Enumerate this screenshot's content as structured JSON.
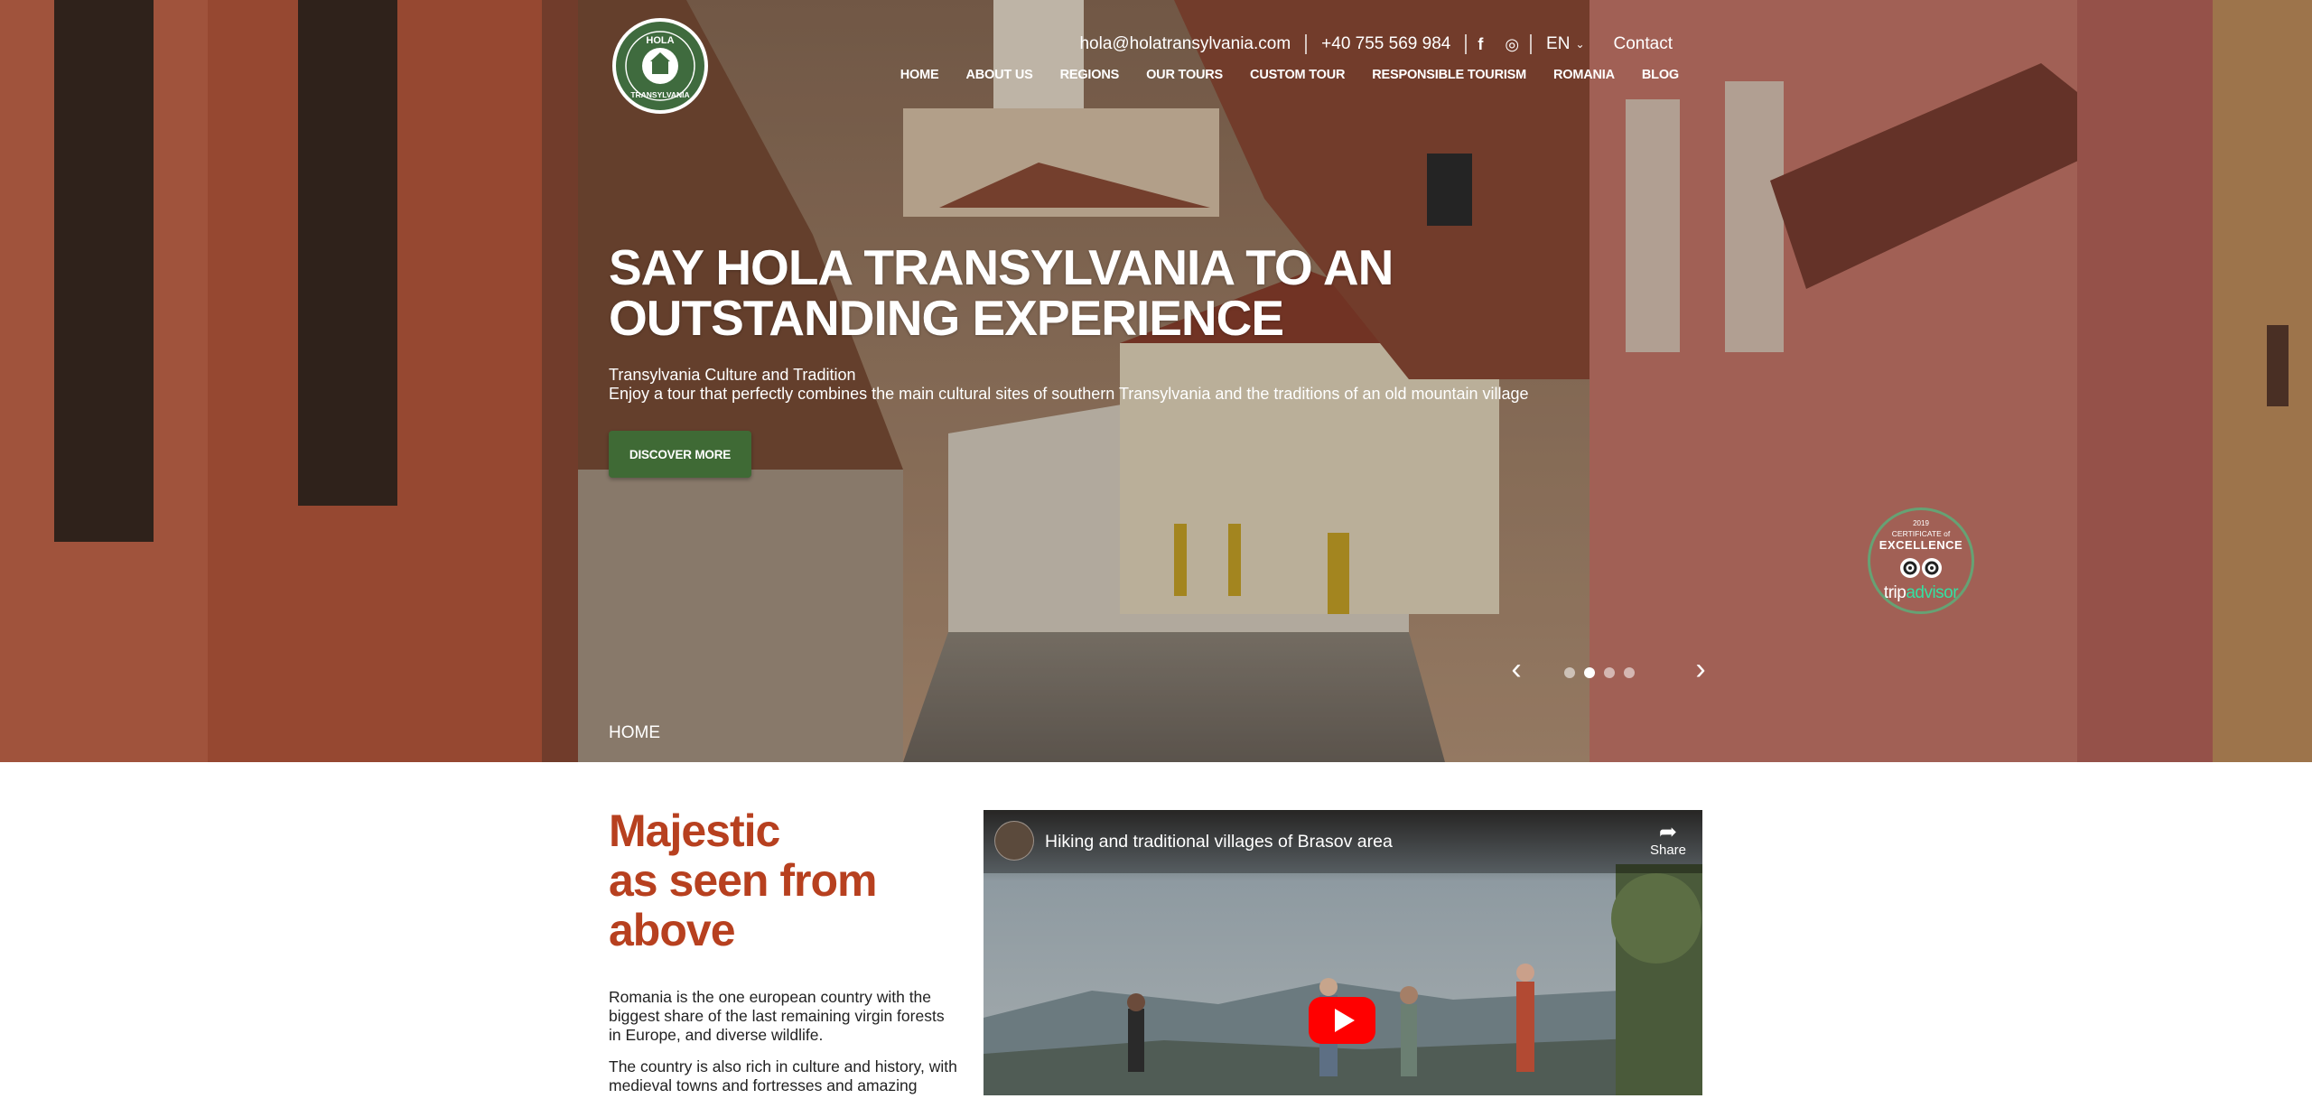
{
  "topbar": {
    "email": "hola@holatransylvania.com",
    "phone": "+40 755 569 984",
    "facebook_icon": "f",
    "instagram_icon": "◎",
    "language": "EN",
    "contact": "Contact"
  },
  "logo": {
    "line1": "HOLA",
    "line2": "TRANSYLVANIA"
  },
  "nav": {
    "items": [
      {
        "label": "HOME"
      },
      {
        "label": "ABOUT US"
      },
      {
        "label": "REGIONS"
      },
      {
        "label": "OUR TOURS"
      },
      {
        "label": "CUSTOM TOUR"
      },
      {
        "label": "RESPONSIBLE TOURISM"
      },
      {
        "label": "ROMANIA"
      },
      {
        "label": "BLOG"
      }
    ]
  },
  "hero": {
    "title_line1": "SAY HOLA TRANSYLVANIA TO AN",
    "title_line2": "OUTSTANDING EXPERIENCE",
    "subtitle_line1": "Transylvania Culture and Tradition",
    "subtitle_line2": "Enjoy a tour that perfectly combines the main cultural sites of southern Transylvania and the traditions of an old mountain village",
    "cta": "DISCOVER MORE",
    "breadcrumb": "HOME",
    "slider": {
      "total": 4,
      "active_index": 1,
      "prev_icon": "‹",
      "next_icon": "›"
    }
  },
  "tripadvisor": {
    "year": "2019",
    "certificate": "CERTIFICATE of",
    "excellence": "EXCELLENCE",
    "brand_a": "trip",
    "brand_b": "advisor"
  },
  "section": {
    "title_line1": "Majestic",
    "title_line2": "as seen from",
    "title_line3": "above",
    "paragraph1": "Romania is the one european country with the biggest share of the last remaining virgin forests in Europe, and diverse wildlife.",
    "paragraph2": "The country is also rich in culture and history, with medieval towns and fortresses and amazing"
  },
  "video": {
    "title": "Hiking and traditional villages of Brasov area",
    "share": "Share"
  },
  "colors": {
    "accent_green": "#3f6a35",
    "title_red": "#b7401f",
    "play_red": "#ff0000"
  }
}
